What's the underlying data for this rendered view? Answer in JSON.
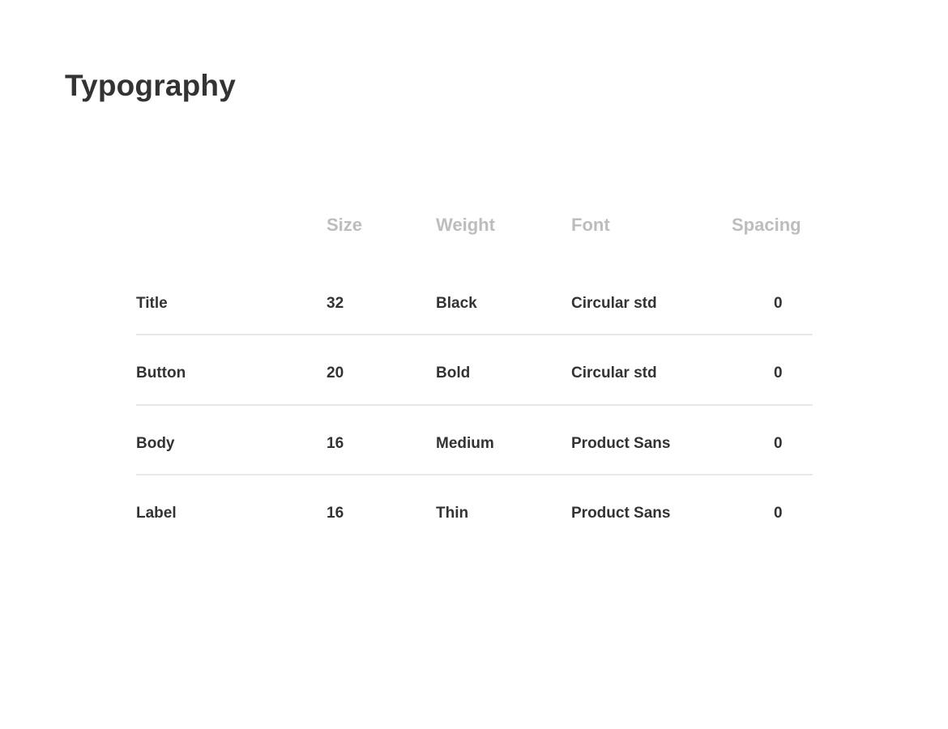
{
  "title": "Typography",
  "colors": {
    "text": "#333333",
    "header_text": "#bdbdbd",
    "divider": "#e8e8e8",
    "background": "#ffffff"
  },
  "table": {
    "columns": {
      "size": "Size",
      "weight": "Weight",
      "font": "Font",
      "spacing": "Spacing"
    },
    "rows": [
      {
        "name": "Title",
        "size": "32",
        "weight": "Black",
        "font": "Circular std",
        "spacing": "0"
      },
      {
        "name": "Button",
        "size": "20",
        "weight": "Bold",
        "font": "Circular std",
        "spacing": "0"
      },
      {
        "name": "Body",
        "size": "16",
        "weight": "Medium",
        "font": "Product Sans",
        "spacing": "0"
      },
      {
        "name": "Label",
        "size": "16",
        "weight": "Thin",
        "font": "Product Sans",
        "spacing": "0"
      }
    ]
  }
}
